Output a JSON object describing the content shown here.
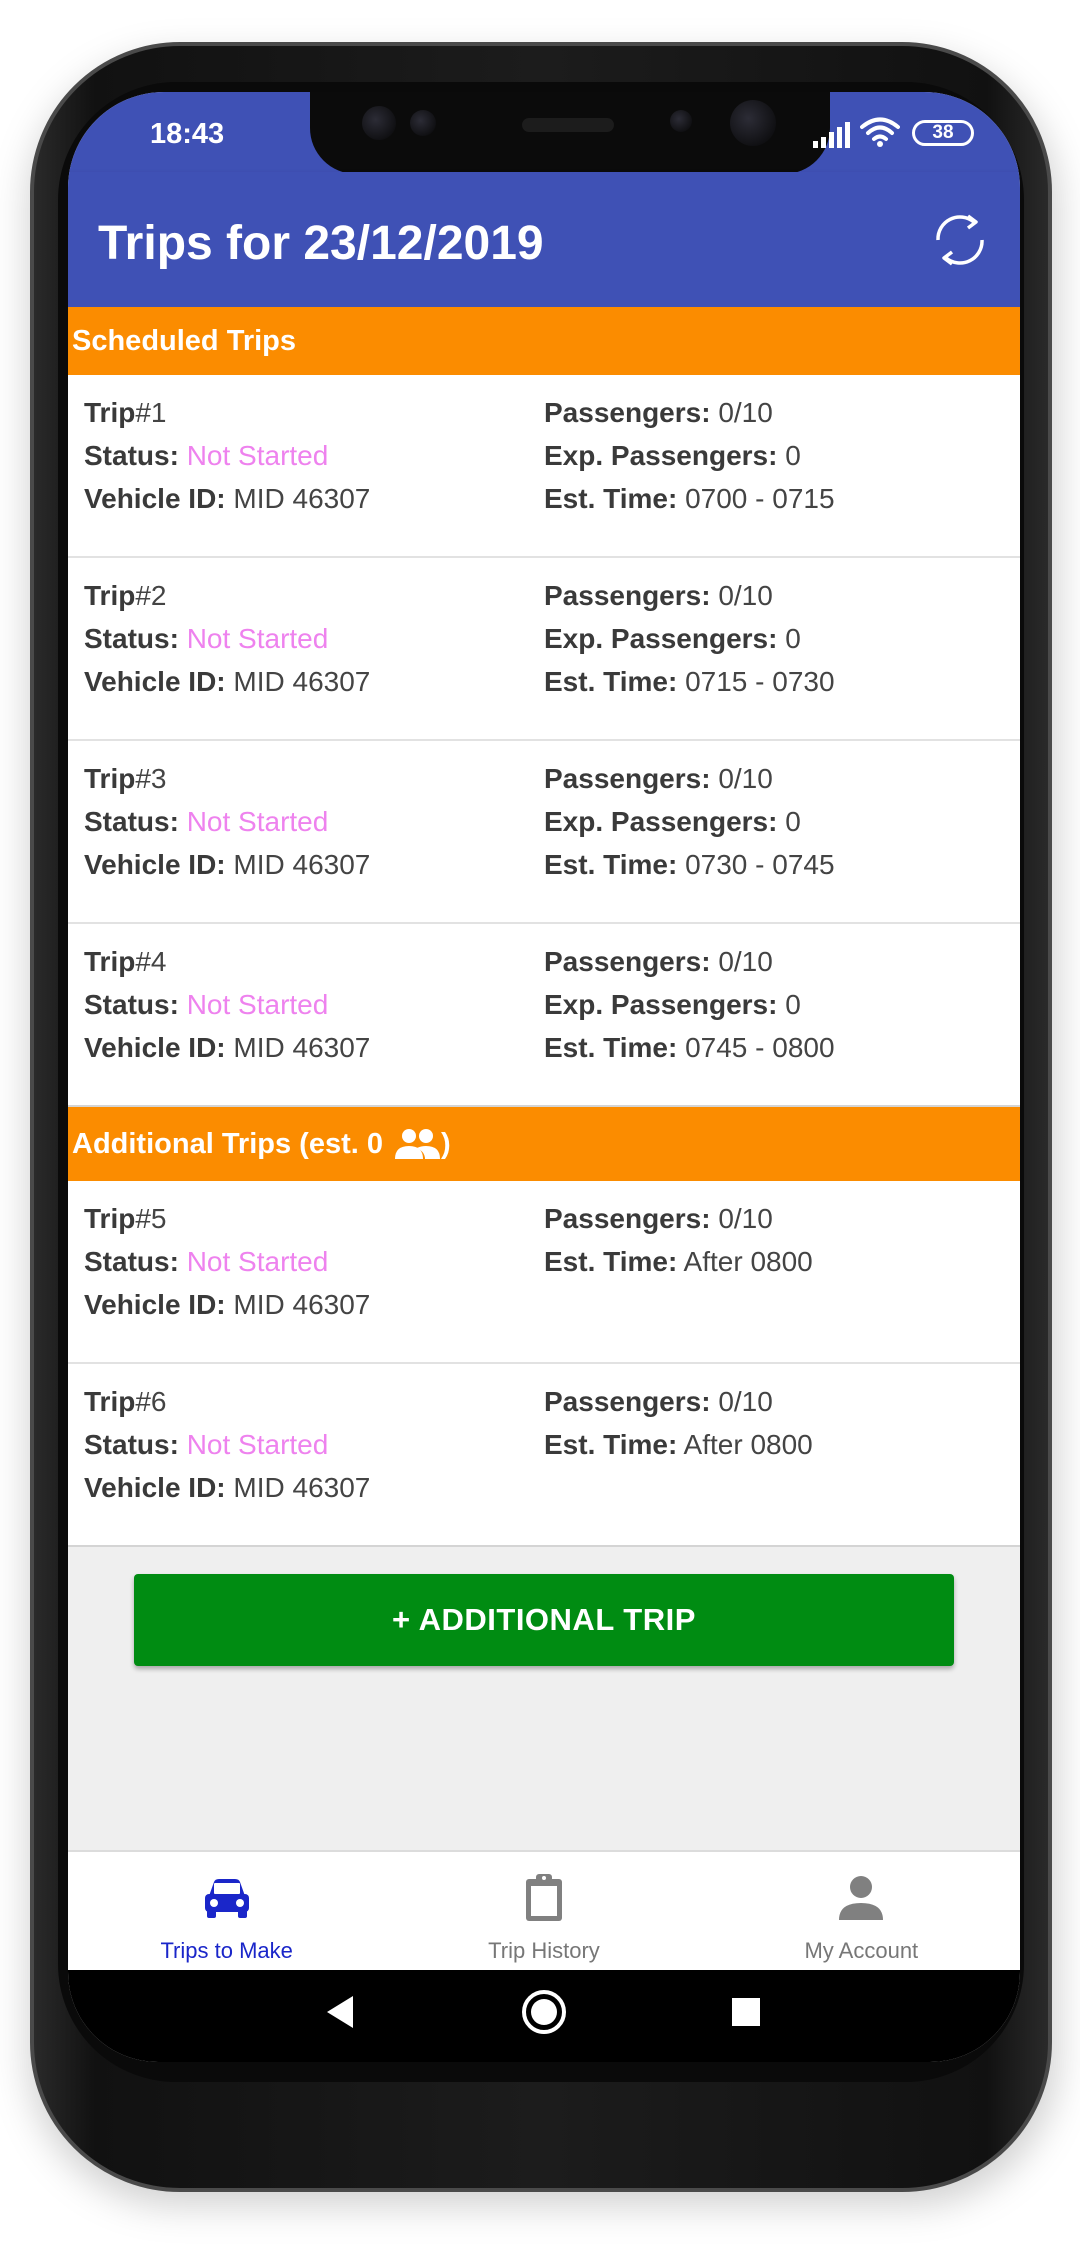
{
  "status_bar": {
    "time": "18:43",
    "battery": "38"
  },
  "app_bar": {
    "title": "Trips for 23/12/2019"
  },
  "scheduled_section": {
    "title": "Scheduled Trips"
  },
  "additional_section": {
    "title_prefix": "Additional Trips (est. 0",
    "title_suffix": ")"
  },
  "labels": {
    "trip": "Trip",
    "status": "Status:",
    "vehicle": "Vehicle ID:",
    "passengers": "Passengers:",
    "exp_passengers": "Exp. Passengers:",
    "est_time": "Est. Time:"
  },
  "scheduled_trips": [
    {
      "number": "#1",
      "status": "Not Started",
      "vehicle": "MID 46307",
      "passengers": "0/10",
      "exp_passengers": "0",
      "est_time": "0700 - 0715"
    },
    {
      "number": "#2",
      "status": "Not Started",
      "vehicle": "MID 46307",
      "passengers": "0/10",
      "exp_passengers": "0",
      "est_time": "0715 - 0730"
    },
    {
      "number": "#3",
      "status": "Not Started",
      "vehicle": "MID 46307",
      "passengers": "0/10",
      "exp_passengers": "0",
      "est_time": "0730 - 0745"
    },
    {
      "number": "#4",
      "status": "Not Started",
      "vehicle": "MID 46307",
      "passengers": "0/10",
      "exp_passengers": "0",
      "est_time": "0745 - 0800"
    }
  ],
  "additional_trips": [
    {
      "number": "#5",
      "status": "Not Started",
      "vehicle": "MID 46307",
      "passengers": "0/10",
      "est_time": "After 0800"
    },
    {
      "number": "#6",
      "status": "Not Started",
      "vehicle": "MID 46307",
      "passengers": "0/10",
      "est_time": "After 0800"
    }
  ],
  "add_trip_button": {
    "label": "+ ADDITIONAL TRIP"
  },
  "bottom_nav": [
    {
      "label": "Trips to Make",
      "icon": "car-icon",
      "active": true
    },
    {
      "label": "Trip History",
      "icon": "clipboard-icon",
      "active": false
    },
    {
      "label": "My Account",
      "icon": "person-icon",
      "active": false
    }
  ],
  "colors": {
    "primary": "#3f51b5",
    "section_header": "#fb8c00",
    "status_not_started": "#ee82ee",
    "add_button": "#008c12",
    "nav_active": "#1a26c9",
    "nav_inactive": "#777777"
  }
}
